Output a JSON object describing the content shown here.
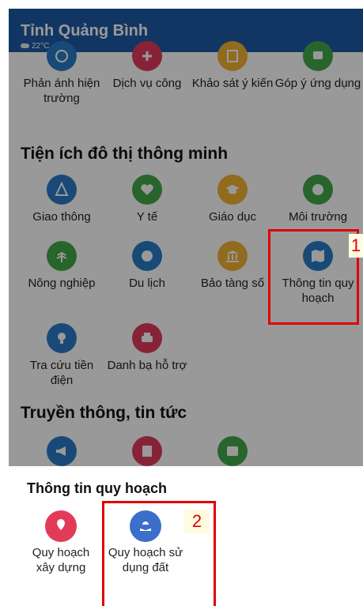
{
  "header": {
    "title": "Tỉnh Quảng Bình",
    "temperature": "22°C"
  },
  "top_row": [
    {
      "label": "Phản ánh hiện trường",
      "color": "#2b7cc7"
    },
    {
      "label": "Dịch vụ công",
      "color": "#e23b5a"
    },
    {
      "label": "Khảo sát ý kiến",
      "color": "#f2b233"
    },
    {
      "label": "Góp ý ứng dụng",
      "color": "#43a84a"
    }
  ],
  "section1": {
    "title": "Tiện ích đô thị thông minh",
    "items": [
      {
        "label": "Giao thông",
        "color": "#2b7cc7"
      },
      {
        "label": "Y tế",
        "color": "#43a84a"
      },
      {
        "label": "Giáo dục",
        "color": "#f2b233"
      },
      {
        "label": "Môi trường",
        "color": "#43a84a"
      },
      {
        "label": "Nông nghiệp",
        "color": "#43a84a"
      },
      {
        "label": "Du lịch",
        "color": "#2b7cc7"
      },
      {
        "label": "Bảo tàng số",
        "color": "#f2b233"
      },
      {
        "label": "Thông tin quy hoạch",
        "color": "#2b7cc7"
      },
      {
        "label": "Tra cứu tiền điện",
        "color": "#2b7cc7"
      },
      {
        "label": "Danh bạ hỗ trợ",
        "color": "#e23b5a"
      }
    ]
  },
  "section2": {
    "title": "Truyền thông, tin tức",
    "items": [
      {
        "label": "",
        "color": "#2b7cc7"
      },
      {
        "label": "",
        "color": "#e23b5a"
      },
      {
        "label": "",
        "color": "#43a84a"
      }
    ]
  },
  "callouts": {
    "one": "1",
    "two": "2"
  },
  "panel": {
    "title": "Thông tin quy hoạch",
    "items": [
      {
        "label": "Quy hoạch xây dựng",
        "color": "#e23b5a"
      },
      {
        "label": "Quy hoạch sử dụng đất",
        "color": "#3b6fc9"
      }
    ]
  }
}
